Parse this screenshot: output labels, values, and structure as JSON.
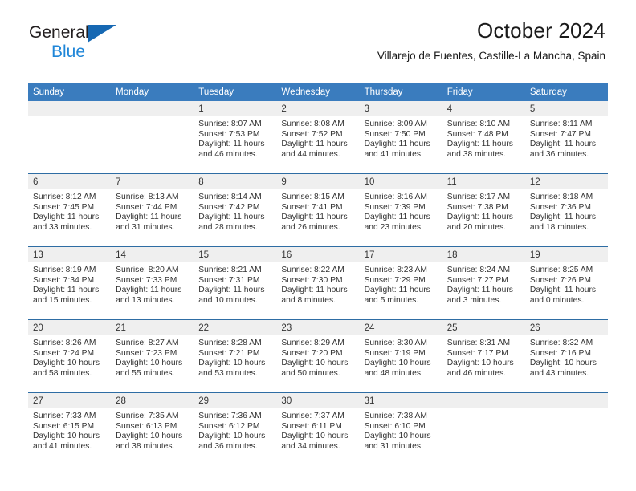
{
  "brand": {
    "name_top": "General",
    "name_bottom": "Blue",
    "triangle_color": "#1668b3",
    "blue_text_color": "#1f86d8"
  },
  "header": {
    "title": "October 2024",
    "location": "Villarejo de Fuentes, Castille-La Mancha, Spain"
  },
  "theme": {
    "header_row_bg": "#3a7cbe",
    "header_row_text": "#ffffff",
    "daynum_bg": "#efefef",
    "row_divider": "#2e6da4",
    "body_text": "#333333"
  },
  "weekday_headers": [
    "Sunday",
    "Monday",
    "Tuesday",
    "Wednesday",
    "Thursday",
    "Friday",
    "Saturday"
  ],
  "labels": {
    "sunrise_prefix": "Sunrise:",
    "sunset_prefix": "Sunset:",
    "daylight_prefix": "Daylight:"
  },
  "weeks": [
    [
      {
        "day": "",
        "empty": true
      },
      {
        "day": "",
        "empty": true
      },
      {
        "day": "1",
        "sunrise": "Sunrise: 8:07 AM",
        "sunset": "Sunset: 7:53 PM",
        "daylight_line1": "Daylight: 11 hours",
        "daylight_line2": "and 46 minutes."
      },
      {
        "day": "2",
        "sunrise": "Sunrise: 8:08 AM",
        "sunset": "Sunset: 7:52 PM",
        "daylight_line1": "Daylight: 11 hours",
        "daylight_line2": "and 44 minutes."
      },
      {
        "day": "3",
        "sunrise": "Sunrise: 8:09 AM",
        "sunset": "Sunset: 7:50 PM",
        "daylight_line1": "Daylight: 11 hours",
        "daylight_line2": "and 41 minutes."
      },
      {
        "day": "4",
        "sunrise": "Sunrise: 8:10 AM",
        "sunset": "Sunset: 7:48 PM",
        "daylight_line1": "Daylight: 11 hours",
        "daylight_line2": "and 38 minutes."
      },
      {
        "day": "5",
        "sunrise": "Sunrise: 8:11 AM",
        "sunset": "Sunset: 7:47 PM",
        "daylight_line1": "Daylight: 11 hours",
        "daylight_line2": "and 36 minutes."
      }
    ],
    [
      {
        "day": "6",
        "sunrise": "Sunrise: 8:12 AM",
        "sunset": "Sunset: 7:45 PM",
        "daylight_line1": "Daylight: 11 hours",
        "daylight_line2": "and 33 minutes."
      },
      {
        "day": "7",
        "sunrise": "Sunrise: 8:13 AM",
        "sunset": "Sunset: 7:44 PM",
        "daylight_line1": "Daylight: 11 hours",
        "daylight_line2": "and 31 minutes."
      },
      {
        "day": "8",
        "sunrise": "Sunrise: 8:14 AM",
        "sunset": "Sunset: 7:42 PM",
        "daylight_line1": "Daylight: 11 hours",
        "daylight_line2": "and 28 minutes."
      },
      {
        "day": "9",
        "sunrise": "Sunrise: 8:15 AM",
        "sunset": "Sunset: 7:41 PM",
        "daylight_line1": "Daylight: 11 hours",
        "daylight_line2": "and 26 minutes."
      },
      {
        "day": "10",
        "sunrise": "Sunrise: 8:16 AM",
        "sunset": "Sunset: 7:39 PM",
        "daylight_line1": "Daylight: 11 hours",
        "daylight_line2": "and 23 minutes."
      },
      {
        "day": "11",
        "sunrise": "Sunrise: 8:17 AM",
        "sunset": "Sunset: 7:38 PM",
        "daylight_line1": "Daylight: 11 hours",
        "daylight_line2": "and 20 minutes."
      },
      {
        "day": "12",
        "sunrise": "Sunrise: 8:18 AM",
        "sunset": "Sunset: 7:36 PM",
        "daylight_line1": "Daylight: 11 hours",
        "daylight_line2": "and 18 minutes."
      }
    ],
    [
      {
        "day": "13",
        "sunrise": "Sunrise: 8:19 AM",
        "sunset": "Sunset: 7:34 PM",
        "daylight_line1": "Daylight: 11 hours",
        "daylight_line2": "and 15 minutes."
      },
      {
        "day": "14",
        "sunrise": "Sunrise: 8:20 AM",
        "sunset": "Sunset: 7:33 PM",
        "daylight_line1": "Daylight: 11 hours",
        "daylight_line2": "and 13 minutes."
      },
      {
        "day": "15",
        "sunrise": "Sunrise: 8:21 AM",
        "sunset": "Sunset: 7:31 PM",
        "daylight_line1": "Daylight: 11 hours",
        "daylight_line2": "and 10 minutes."
      },
      {
        "day": "16",
        "sunrise": "Sunrise: 8:22 AM",
        "sunset": "Sunset: 7:30 PM",
        "daylight_line1": "Daylight: 11 hours",
        "daylight_line2": "and 8 minutes."
      },
      {
        "day": "17",
        "sunrise": "Sunrise: 8:23 AM",
        "sunset": "Sunset: 7:29 PM",
        "daylight_line1": "Daylight: 11 hours",
        "daylight_line2": "and 5 minutes."
      },
      {
        "day": "18",
        "sunrise": "Sunrise: 8:24 AM",
        "sunset": "Sunset: 7:27 PM",
        "daylight_line1": "Daylight: 11 hours",
        "daylight_line2": "and 3 minutes."
      },
      {
        "day": "19",
        "sunrise": "Sunrise: 8:25 AM",
        "sunset": "Sunset: 7:26 PM",
        "daylight_line1": "Daylight: 11 hours",
        "daylight_line2": "and 0 minutes."
      }
    ],
    [
      {
        "day": "20",
        "sunrise": "Sunrise: 8:26 AM",
        "sunset": "Sunset: 7:24 PM",
        "daylight_line1": "Daylight: 10 hours",
        "daylight_line2": "and 58 minutes."
      },
      {
        "day": "21",
        "sunrise": "Sunrise: 8:27 AM",
        "sunset": "Sunset: 7:23 PM",
        "daylight_line1": "Daylight: 10 hours",
        "daylight_line2": "and 55 minutes."
      },
      {
        "day": "22",
        "sunrise": "Sunrise: 8:28 AM",
        "sunset": "Sunset: 7:21 PM",
        "daylight_line1": "Daylight: 10 hours",
        "daylight_line2": "and 53 minutes."
      },
      {
        "day": "23",
        "sunrise": "Sunrise: 8:29 AM",
        "sunset": "Sunset: 7:20 PM",
        "daylight_line1": "Daylight: 10 hours",
        "daylight_line2": "and 50 minutes."
      },
      {
        "day": "24",
        "sunrise": "Sunrise: 8:30 AM",
        "sunset": "Sunset: 7:19 PM",
        "daylight_line1": "Daylight: 10 hours",
        "daylight_line2": "and 48 minutes."
      },
      {
        "day": "25",
        "sunrise": "Sunrise: 8:31 AM",
        "sunset": "Sunset: 7:17 PM",
        "daylight_line1": "Daylight: 10 hours",
        "daylight_line2": "and 46 minutes."
      },
      {
        "day": "26",
        "sunrise": "Sunrise: 8:32 AM",
        "sunset": "Sunset: 7:16 PM",
        "daylight_line1": "Daylight: 10 hours",
        "daylight_line2": "and 43 minutes."
      }
    ],
    [
      {
        "day": "27",
        "sunrise": "Sunrise: 7:33 AM",
        "sunset": "Sunset: 6:15 PM",
        "daylight_line1": "Daylight: 10 hours",
        "daylight_line2": "and 41 minutes."
      },
      {
        "day": "28",
        "sunrise": "Sunrise: 7:35 AM",
        "sunset": "Sunset: 6:13 PM",
        "daylight_line1": "Daylight: 10 hours",
        "daylight_line2": "and 38 minutes."
      },
      {
        "day": "29",
        "sunrise": "Sunrise: 7:36 AM",
        "sunset": "Sunset: 6:12 PM",
        "daylight_line1": "Daylight: 10 hours",
        "daylight_line2": "and 36 minutes."
      },
      {
        "day": "30",
        "sunrise": "Sunrise: 7:37 AM",
        "sunset": "Sunset: 6:11 PM",
        "daylight_line1": "Daylight: 10 hours",
        "daylight_line2": "and 34 minutes."
      },
      {
        "day": "31",
        "sunrise": "Sunrise: 7:38 AM",
        "sunset": "Sunset: 6:10 PM",
        "daylight_line1": "Daylight: 10 hours",
        "daylight_line2": "and 31 minutes."
      },
      {
        "day": "",
        "empty": true
      },
      {
        "day": "",
        "empty": true
      }
    ]
  ]
}
